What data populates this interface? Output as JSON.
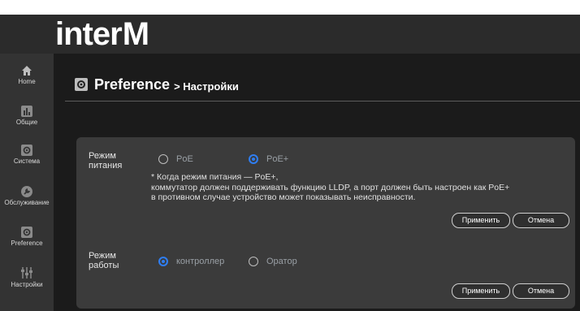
{
  "header": {
    "logo_text": "inter",
    "logo_mark": "M"
  },
  "sidebar": {
    "items": [
      {
        "label": "Home",
        "icon": "home-icon"
      },
      {
        "label": "Общие",
        "icon": "chart-icon"
      },
      {
        "label": "Система",
        "icon": "gear-icon"
      },
      {
        "label": "Обслуживание",
        "icon": "wrench-icon"
      },
      {
        "label": "Preference",
        "icon": "gear-icon"
      },
      {
        "label": "Настройки",
        "icon": "sliders-icon"
      }
    ]
  },
  "page": {
    "title": "Preference",
    "subtitle": "> Настройки"
  },
  "power_mode": {
    "label_line1": "Режим",
    "label_line2": "питания",
    "options": [
      {
        "label": "PoE",
        "selected": false
      },
      {
        "label": "PoE+",
        "selected": true
      }
    ],
    "note_line1": "* Когда режим питания — PoE+,",
    "note_line2": "коммутатор должен поддерживать функцию LLDP, а порт должен быть настроен как PoE+",
    "note_line3": "в противном случае устройство может показывать неисправности.",
    "apply_label": "Применить",
    "cancel_label": "Отмена"
  },
  "work_mode": {
    "label_line1": "Режим",
    "label_line2": "работы",
    "options": [
      {
        "label": "контроллер",
        "selected": true
      },
      {
        "label": "Оратор",
        "selected": false
      }
    ],
    "apply_label": "Применить",
    "cancel_label": "Отмена"
  },
  "colors": {
    "accent": "#2f7df0",
    "topbar": "#2b2b2b",
    "sidebar": "#333333",
    "main": "#1b1b1b",
    "card": "#3b3b3b"
  }
}
